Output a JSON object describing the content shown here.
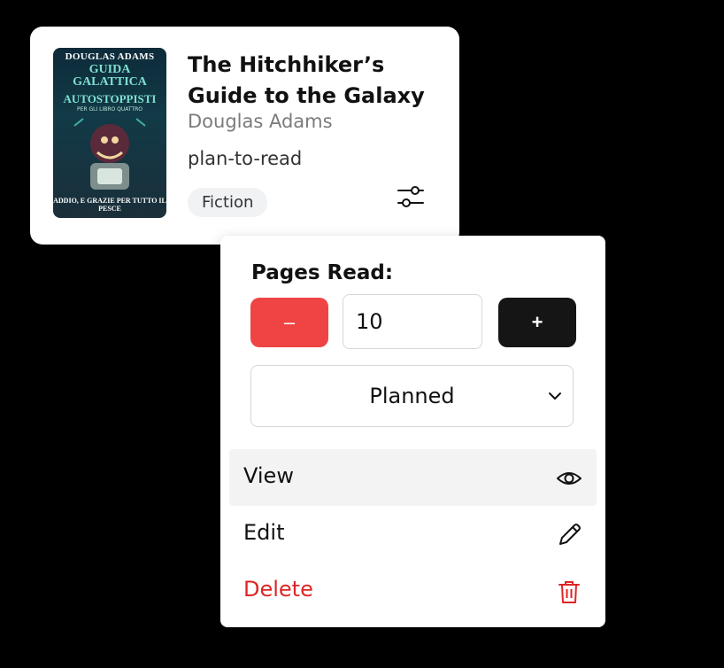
{
  "book": {
    "cover": {
      "author": "DOUGLAS ADAMS",
      "title_line1": "GUIDA GALATTICA",
      "title_line2": "PER GLI",
      "title_line3": "AUTOSTOPPISTI",
      "subtitle": "LIBRO QUATTRO",
      "footer": "ADDIO, E GRAZIE PER TUTTO IL PESCE"
    },
    "title": "The Hitchhiker’s Guide to the Galaxy",
    "author": "Douglas Adams",
    "status": "plan-to-read",
    "genre": "Fiction",
    "settings_icon": "sliders-icon"
  },
  "menu": {
    "pages_label": "Pages Read:",
    "decrement_label": "–",
    "increment_label": "+",
    "pages_value": "10",
    "status_select": "Planned",
    "items": [
      {
        "label": "View",
        "icon": "eye-icon"
      },
      {
        "label": "Edit",
        "icon": "pencil-icon"
      },
      {
        "label": "Delete",
        "icon": "trash-icon"
      }
    ]
  },
  "colors": {
    "danger": "#ef4444",
    "delete_text": "#dc2626",
    "primary_dark": "#151515"
  }
}
